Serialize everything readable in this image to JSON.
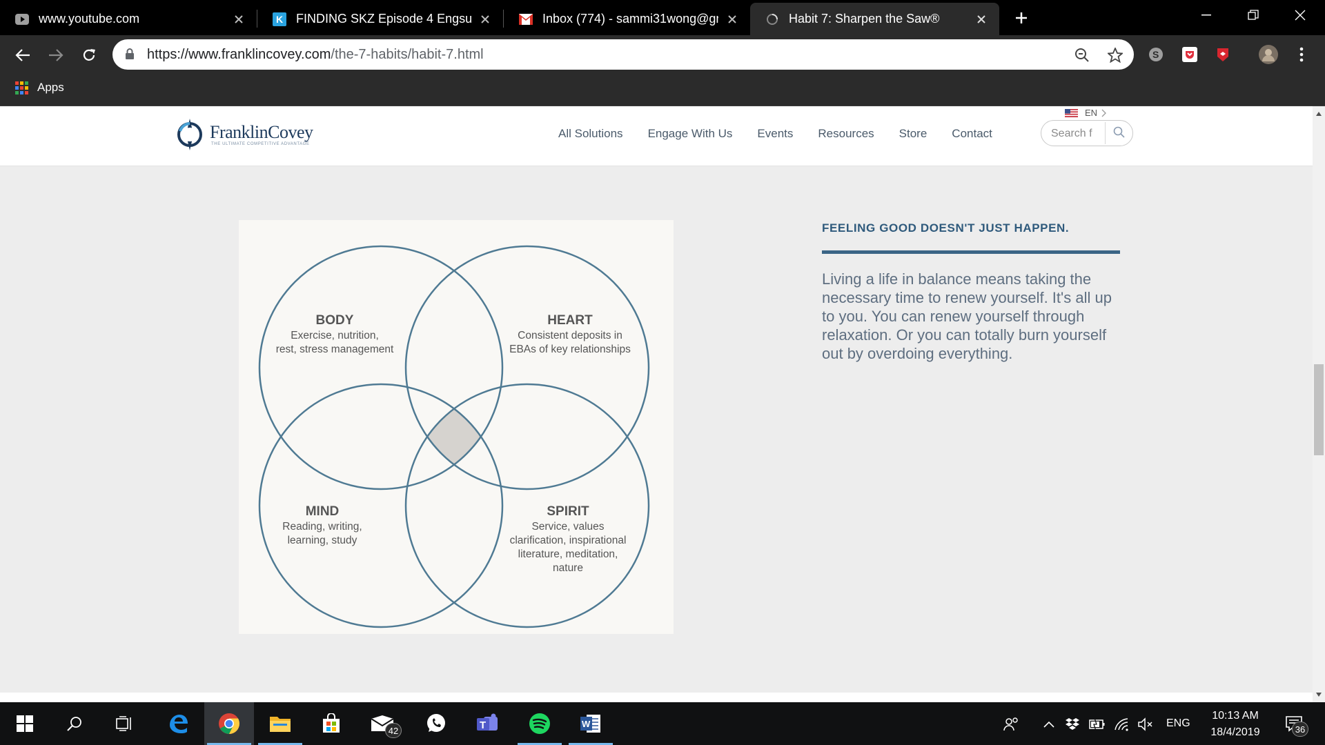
{
  "browser": {
    "tabs": [
      {
        "title": "www.youtube.com",
        "favicon": "youtube-icon"
      },
      {
        "title": "FINDING SKZ Episode 4 Engsub |",
        "favicon": "k-site-icon"
      },
      {
        "title": "Inbox (774) - sammi31wong@gm",
        "favicon": "gmail-icon"
      },
      {
        "title": "Habit 7: Sharpen the Saw®",
        "favicon": "loading-icon",
        "active": true
      }
    ],
    "url": {
      "scheme_host": "https://www.franklincovey.com",
      "path": "/the-7-habits/habit-7.html"
    },
    "bookmarks": {
      "apps_label": "Apps"
    }
  },
  "site": {
    "logo": {
      "name": "FranklinCovey",
      "tagline": "THE ULTIMATE COMPETITIVE ADVANTAGE"
    },
    "language": "EN",
    "nav": [
      "All Solutions",
      "Engage With Us",
      "Events",
      "Resources",
      "Store",
      "Contact"
    ],
    "search_placeholder": "Search f"
  },
  "venn": {
    "circles": [
      {
        "title": "BODY",
        "desc": [
          "Exercise, nutrition,",
          "rest, stress management"
        ]
      },
      {
        "title": "HEART",
        "desc": [
          "Consistent deposits in",
          "EBAs of key relationships"
        ]
      },
      {
        "title": "MIND",
        "desc": [
          "Reading, writing,",
          "learning, study"
        ]
      },
      {
        "title": "SPIRIT",
        "desc": [
          "Service, values",
          "clarification, inspirational",
          "literature, meditation,",
          "nature"
        ]
      }
    ],
    "stroke_color": "#4f7a93",
    "center_fill": "#d6d3cf"
  },
  "content": {
    "heading": "FEELING GOOD DOESN'T JUST HAPPEN.",
    "body": "Living a life in balance means taking the necessary time to renew yourself. It's all up to you. You can renew yourself through relaxation. Or you can totally burn yourself out by overdoing everything."
  },
  "taskbar": {
    "mail_badge": "42",
    "language": "ENG",
    "time": "10:13 AM",
    "date": "18/4/2019",
    "notifications": "36"
  },
  "colors": {
    "brand_blue": "#2f5a7c",
    "text_gray": "#5e6e80",
    "page_bg": "#ededed"
  }
}
